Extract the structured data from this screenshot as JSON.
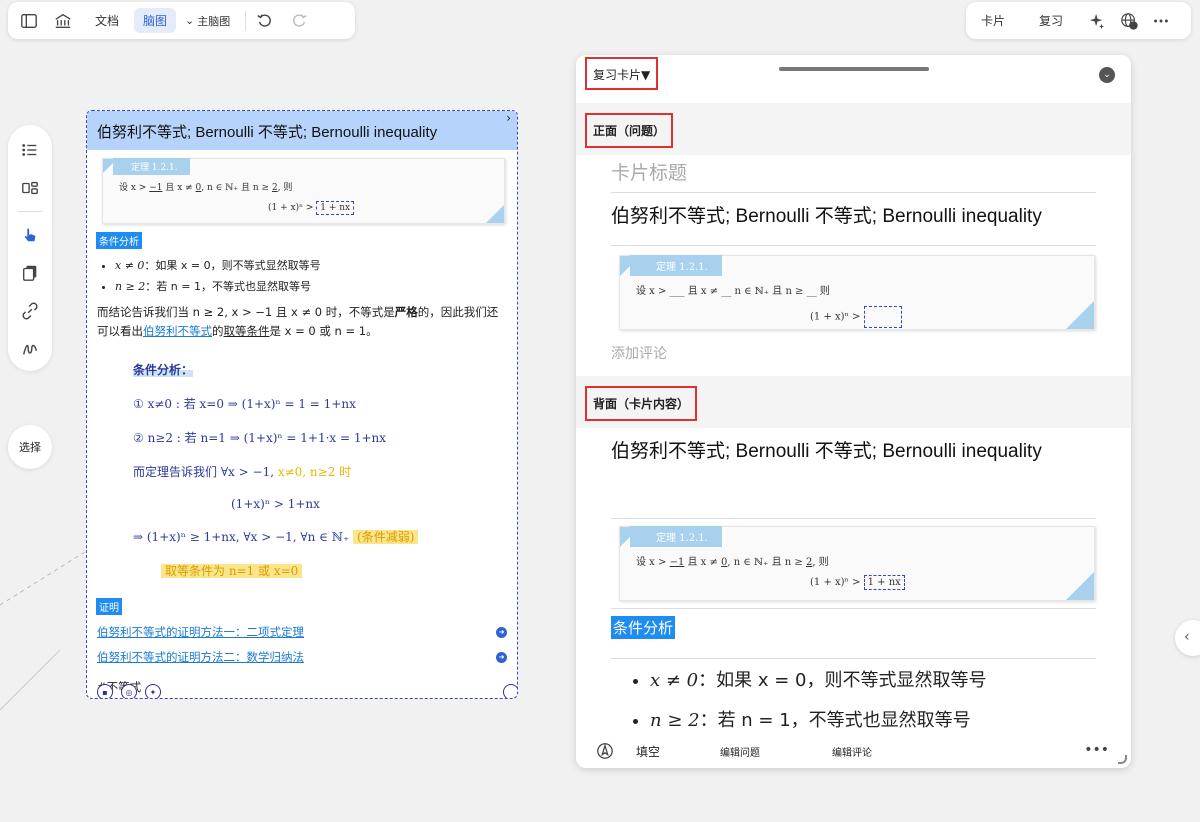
{
  "top_toolbar": {
    "doc": "文档",
    "mindmap": "脑图",
    "topic_select": "主脑图"
  },
  "right_toolbar": {
    "card": "卡片",
    "review": "复习"
  },
  "left_rail": {
    "select": "选择"
  },
  "node": {
    "title": "伯努利不等式; Bernoulli 不等式; Bernoulli inequality",
    "theorem_badge": "定理 1.2.1.",
    "theorem_line1_a": "设 x > ",
    "theorem_line1_b": "−1",
    "theorem_line1_c": " 且 x ≠ ",
    "theorem_line1_d": "0",
    "theorem_line1_e": ", n ∈ ℕ₊ 且 n ≥ ",
    "theorem_line1_f": "2",
    "theorem_line1_g": ", 则",
    "theorem_line2_a": "(1 + x)ⁿ >",
    "theorem_line2_b": "1 + nx",
    "tag_condition": "条件分析",
    "bullet1_math": "x ≠ 0",
    "bullet1_text": "：如果 x = 0，则不等式显然取等号",
    "bullet2_math": "n ≥ 2",
    "bullet2_text": "：若 n = 1，不等式也显然取等号",
    "para_a": "而结论告诉我们当 n ≥ 2, x > −1 且 x ≠ 0 时，不等式是",
    "para_bold": "严格",
    "para_b": "的，因此我们还可以看出",
    "para_link": "伯努利不等式",
    "para_c": "的",
    "para_ul": "取等条件",
    "para_d": "是 x = 0 或 n = 1。",
    "hand_title": "条件分析：",
    "hand_1": "① x≠0 : 若 x=0 ⇒ (1+x)ⁿ = 1 = 1+nx",
    "hand_2": "② n≥2 : 若 n=1 ⇒ (1+x)ⁿ = 1+1·x = 1+nx",
    "hand_3a": "而定理告诉我们 ∀x > −1,",
    "hand_3b": "x≠0, n≥2 时",
    "hand_4": "(1+x)ⁿ > 1+nx",
    "hand_5a": "⇒ (1+x)ⁿ ≥ 1+nx, ∀x > −1, ∀n ∈ ℕ₊",
    "hand_5b": "(条件减弱)",
    "hand_6": "取等条件为 n=1 或 x=0",
    "tag_proof": "证明",
    "link1": "伯努利不等式的证明方法一：二项式定理",
    "link2": "伯努利不等式的证明方法二：数学归纳法",
    "hashtag": "#不等式"
  },
  "panel": {
    "header": "复习卡片▼",
    "front_label": "正面（问题）",
    "card_title_placeholder": "卡片标题",
    "card_title": "伯努利不等式; Bernoulli 不等式; Bernoulli inequality",
    "front_theorem_line1": "设 x > ___ 且 x ≠ __ n ∈ ℕ₊ 且 n ≥ __ 则",
    "front_theorem_line2": "(1 + x)ⁿ >",
    "comment_placeholder": "添加评论",
    "back_label": "背面（卡片内容）",
    "back_title": "伯努利不等式; Bernoulli 不等式; Bernoulli inequality",
    "back_tag": "条件分析",
    "back_bullet1_math": "x ≠ 0",
    "back_bullet1_text": "：如果 x = 0，则不等式显然取等号",
    "back_bullet2_math": "n ≥ 2",
    "back_bullet2_text": "：若 n = 1，不等式也显然取等号",
    "footer_fill": "填空",
    "footer_edit_question": "编辑问题",
    "footer_edit_comment": "编辑评论"
  }
}
